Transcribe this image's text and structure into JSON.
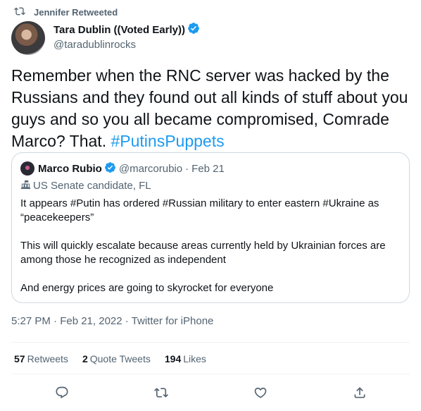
{
  "retweet_context": {
    "text": "Jennifer Retweeted"
  },
  "author": {
    "name": "Tara Dublin ((Voted Early))",
    "handle": "@taradublinrocks"
  },
  "tweet": {
    "text": "Remember when the RNC server was hacked by the Russians and they found out all kinds of stuff about you guys and so you all became compromised, Comrade Marco? That. ",
    "hashtag": "#PutinsPuppets"
  },
  "quoted_tweet": {
    "name": "Marco Rubio",
    "handle": "@marcorubio",
    "separator": "·",
    "date": "Feb 21",
    "label": "US Senate candidate, FL",
    "paragraphs": [
      "It appears #Putin has ordered #Russian military to enter eastern #Ukraine as “peacekeepers”",
      "This will quickly escalate because areas currently held by Ukrainian forces are among those he recognized as independent",
      "And energy prices are going to skyrocket for everyone"
    ]
  },
  "timestamp": "5:27 PM · Feb 21, 2022 · Twitter for iPhone",
  "stats": {
    "retweets_count": "57",
    "retweets_label": "Retweets",
    "quotes_count": "2",
    "quotes_label": "Quote Tweets",
    "likes_count": "194",
    "likes_label": "Likes"
  },
  "actions": {
    "reply_icon": "reply-icon",
    "retweet_icon": "retweet-icon",
    "like_icon": "heart-icon",
    "share_icon": "share-icon"
  },
  "colors": {
    "accent": "#1d9bf0",
    "text_primary": "#0f1419",
    "text_secondary": "#536471",
    "border": "#cfd9de"
  }
}
